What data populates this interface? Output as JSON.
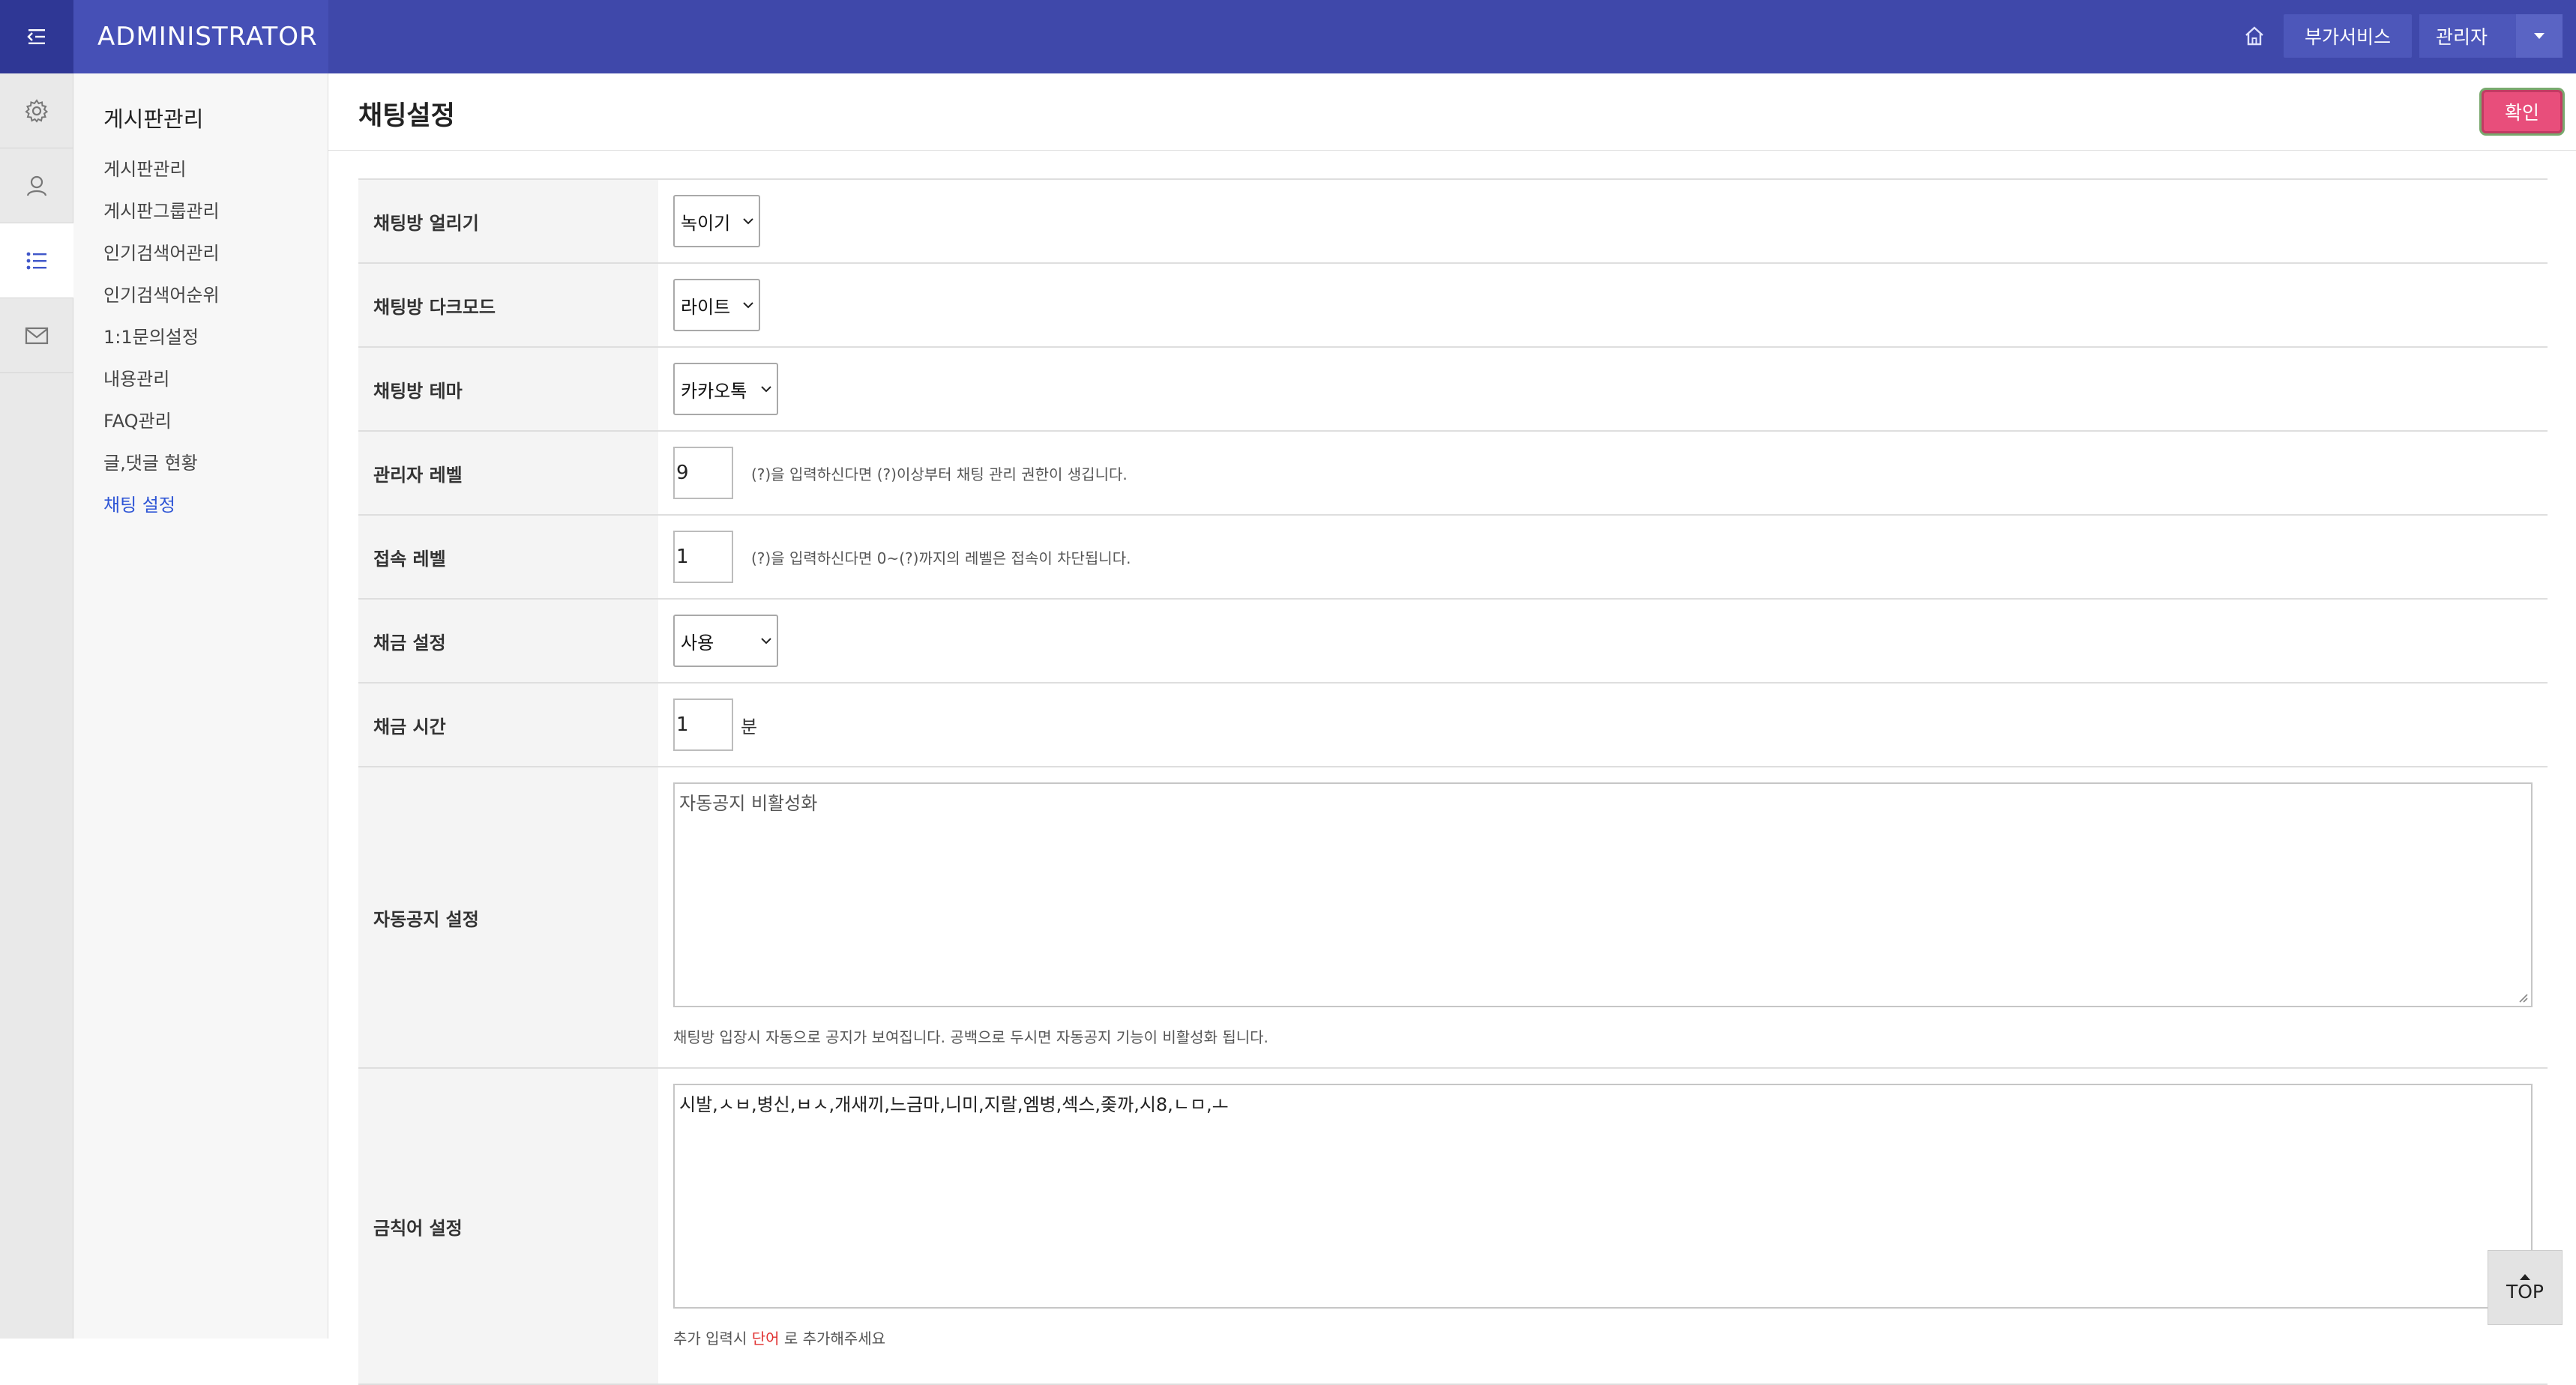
{
  "header": {
    "brand": "ADMINISTRATOR",
    "addon_label": "부가서비스",
    "admin_label": "관리자"
  },
  "rail": {
    "icons": [
      "gear-icon",
      "user-icon",
      "list-icon",
      "mail-icon"
    ],
    "active_index": 2
  },
  "submenu": {
    "title": "게시판관리",
    "items": [
      {
        "label": "게시판관리"
      },
      {
        "label": "게시판그룹관리"
      },
      {
        "label": "인기검색어관리"
      },
      {
        "label": "인기검색어순위"
      },
      {
        "label": "1:1문의설정"
      },
      {
        "label": "내용관리"
      },
      {
        "label": "FAQ관리"
      },
      {
        "label": "글,댓글 현황"
      },
      {
        "label": "채팅 설정"
      }
    ],
    "active_index": 8
  },
  "page": {
    "title": "채팅설정",
    "confirm_label": "확인"
  },
  "form": {
    "freeze_label": "채팅방 얼리기",
    "freeze_value": "녹이기",
    "dark_label": "채팅방 다크모드",
    "dark_value": "라이트",
    "theme_label": "채팅방 테마",
    "theme_value": "카카오톡",
    "admin_level_label": "관리자 레벨",
    "admin_level_value": "9",
    "admin_level_hint": "(?)을 입력하신다면 (?)이상부터 채팅 관리 권한이 생깁니다.",
    "access_level_label": "접속 레벨",
    "access_level_value": "1",
    "access_level_hint": "(?)을 입력하신다면 0~(?)까지의 레벨은 접속이 차단됩니다.",
    "ban_label": "채금 설정",
    "ban_value": "사용",
    "ban_time_label": "채금 시간",
    "ban_time_value": "1",
    "ban_time_unit": "분",
    "auto_notice_label": "자동공지 설정",
    "auto_notice_value": "자동공지 비활성화",
    "auto_notice_note": "채팅방 입장시 자동으로 공지가 보여집니다. 공백으로 두시면 자동공지 기능이 비활성화 됩니다.",
    "badword_label": "금칙어 설정",
    "badword_value": "시발,ㅅㅂ,병신,ㅂㅅ,개새끼,느금마,니미,지랄,엠병,섹스,좆까,시8,ㄴㅁ,ㅗ",
    "badword_note_pre": "추가 입력시",
    "badword_note_em": "단어",
    "badword_note_post": "로 추가해주세요"
  },
  "top_button": "TOP"
}
